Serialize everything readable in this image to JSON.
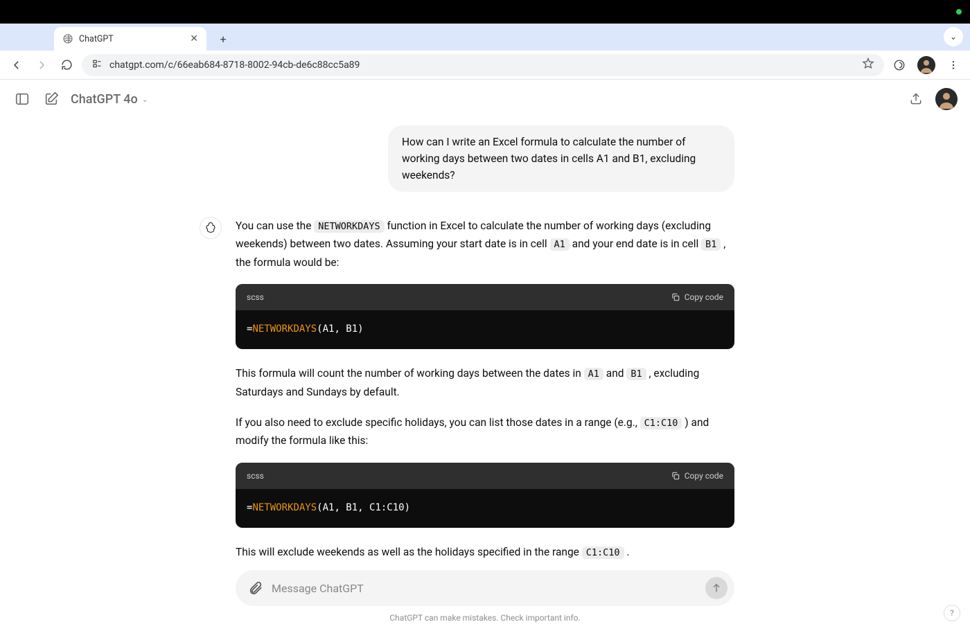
{
  "browser": {
    "tab_title": "ChatGPT",
    "url": "chatgpt.com/c/66eab684-8718-8002-94cb-de6c88cc5a89"
  },
  "header": {
    "model": "ChatGPT 4o"
  },
  "chat": {
    "user_message": "How can I write an Excel formula to calculate the number of working days between two dates in cells A1 and B1, excluding weekends?",
    "assistant": {
      "p1_a": "You can use the ",
      "p1_code1": "NETWORKDAYS",
      "p1_b": " function in Excel to calculate the number of working days (excluding weekends) between two dates. Assuming your start date is in cell ",
      "p1_code2": "A1",
      "p1_c": " and your end date is in cell ",
      "p1_code3": "B1",
      "p1_d": " , the formula would be:",
      "code1": {
        "lang": "scss",
        "copy": "Copy code",
        "eq": "=",
        "fn": "NETWORKDAYS",
        "args": "(A1, B1)"
      },
      "p2_a": "This formula will count the number of working days between the dates in ",
      "p2_code1": "A1",
      "p2_b": " and ",
      "p2_code2": "B1",
      "p2_c": " , excluding Saturdays and Sundays by default.",
      "p3_a": "If you also need to exclude specific holidays, you can list those dates in a range (e.g., ",
      "p3_code1": "C1:C10",
      "p3_b": " ) and modify the formula like this:",
      "code2": {
        "lang": "scss",
        "copy": "Copy code",
        "eq": "=",
        "fn": "NETWORKDAYS",
        "args": "(A1, B1, C1:C10)"
      },
      "p4_a": "This will exclude weekends as well as the holidays specified in the range ",
      "p4_code1": "C1:C10",
      "p4_b": " ."
    }
  },
  "composer": {
    "placeholder": "Message ChatGPT"
  },
  "footer": "ChatGPT can make mistakes. Check important info."
}
